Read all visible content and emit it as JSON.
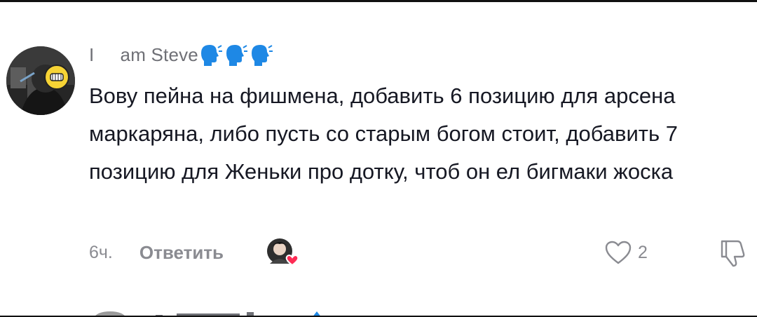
{
  "comment": {
    "username": "I     am Steve",
    "username_emoji": "speaking-head-emoji",
    "text": "Вову пейна на фишмена, добавить 6 позицию для арсена маркаряна, либо пусть со старым богом стоит, добавить 7 позицию для Женьки про дотку, чтоб он ел бигмаки жоска",
    "time": "6ч.",
    "reply_label": "Ответить",
    "like_count": "2",
    "icons": {
      "like": "heart-outline-icon",
      "dislike": "thumbs-down-icon",
      "creator_liked": "creator-liked-avatar-heart-icon"
    }
  },
  "colors": {
    "text": "#161823",
    "secondary": "#8a8b91",
    "username": "#6f7076",
    "emoji_blue": "#1e88e5",
    "heart_red": "#fe2c55"
  }
}
